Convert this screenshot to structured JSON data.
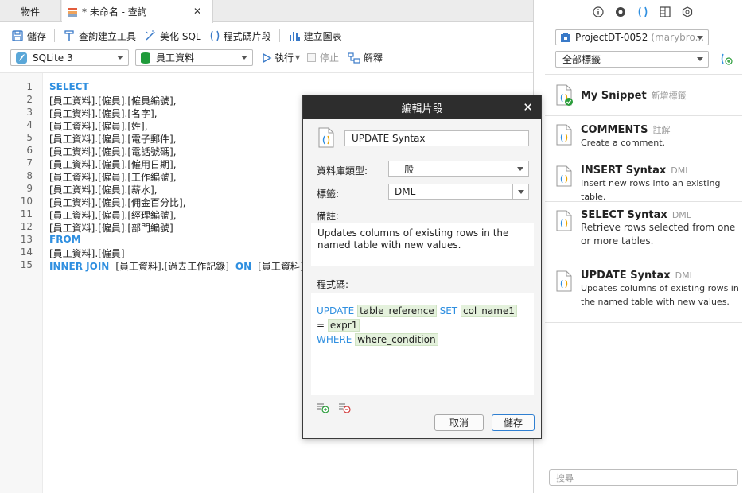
{
  "tabs": {
    "objects": "物件",
    "query": "* 未命名 - 查詢"
  },
  "toolbar": {
    "save": "儲存",
    "query_builder": "查詢建立工具",
    "beautify": "美化 SQL",
    "snippet": "程式碼片段",
    "chart": "建立圖表",
    "db_select": "SQLite 3",
    "schema_select": "員工資料",
    "run": "執行",
    "stop": "停止",
    "explain": "解釋"
  },
  "editor": {
    "line_numbers": [
      "1",
      "2",
      "3",
      "4",
      "5",
      "6",
      "7",
      "8",
      "9",
      "10",
      "11",
      "12",
      "13",
      "14",
      "15"
    ],
    "lines": [
      "SELECT",
      "[員工資料].[僱員].[僱員編號],",
      "[員工資料].[僱員].[名字],",
      "[員工資料].[僱員].[姓],",
      "[員工資料].[僱員].[電子郵件],",
      "[員工資料].[僱員].[電話號碼],",
      "[員工資料].[僱員].[僱用日期],",
      "[員工資料].[僱員].[工作編號],",
      "[員工資料].[僱員].[薪水],",
      "[員工資料].[僱員].[佣金百分比],",
      "[員工資料].[僱員].[經理編號],",
      "[員工資料].[僱員].[部門編號]",
      "FROM",
      "[員工資料].[僱員]",
      ""
    ],
    "line15": {
      "kw1": "INNER JOIN",
      "t1": "[員工資料].[過去工作記錄]",
      "kw2": "ON",
      "t2": "[員工資料]"
    }
  },
  "right_panel": {
    "connection": "ProjectDT-0052",
    "connection_user": "(marybro...",
    "tag_filter": "全部標籤",
    "search_placeholder": "搜尋",
    "snippets": [
      {
        "title": "My Snippet",
        "tag": "新增標籤",
        "desc": ""
      },
      {
        "title": "COMMENTS",
        "tag": "註解",
        "desc": "Create a comment."
      },
      {
        "title": "INSERT Syntax",
        "tag": "DML",
        "desc": "Insert new rows into an existing table."
      },
      {
        "title": "SELECT Syntax",
        "tag": "DML",
        "desc": "Retrieve rows selected from one or more tables."
      },
      {
        "title": "UPDATE Syntax",
        "tag": "DML",
        "desc": "Updates columns of existing rows in the named table with new values."
      }
    ]
  },
  "dialog": {
    "title": "編輯片段",
    "name": "UPDATE Syntax",
    "db_type_label": "資料庫類型:",
    "db_type": "一般",
    "tag_label": "標籤:",
    "tag": "DML",
    "desc_label": "備註:",
    "desc": "Updates columns of existing rows in the named table with new values.",
    "code_label": "程式碼:",
    "code": {
      "kw_update": "UPDATE",
      "ph_table": "table_reference",
      "kw_set": "SET",
      "ph_col": "col_name1",
      "eq": "=",
      "ph_expr": "expr1",
      "kw_where": "WHERE",
      "ph_where": "where_condition"
    },
    "cancel": "取消",
    "save": "儲存"
  },
  "colors": {
    "keyword": "#2f8fe0",
    "placeholder_bg": "#e4f1dc",
    "dialog_title_bg": "#2d2d2d",
    "accent": "#2f7fd1"
  }
}
